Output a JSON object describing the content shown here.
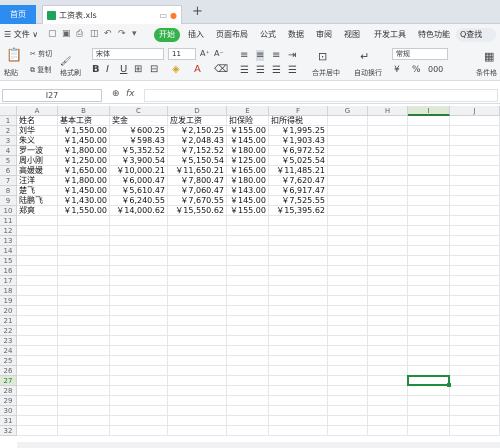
{
  "tabs": {
    "home": "首页",
    "file": "工资表.xls",
    "add": "+"
  },
  "menu": {
    "file": "☰ 文件 ∨",
    "start": "开始",
    "items": [
      "插入",
      "页面布局",
      "公式",
      "数据",
      "审阅",
      "视图",
      "开发工具",
      "特色功能"
    ],
    "search": "Q查找"
  },
  "ribbon": {
    "paste": "粘贴",
    "cut": "剪切",
    "copy": "复制",
    "format_painter": "格式刷",
    "font": "宋体",
    "font_size": "11",
    "merge": "合并居中",
    "wrap": "自动换行",
    "number_format": "常规",
    "currency": "¥",
    "percent": "%",
    "conditional": "条件格"
  },
  "formula_bar": {
    "name_box": "I27",
    "fx": "fx"
  },
  "columns": [
    "A",
    "B",
    "C",
    "D",
    "E",
    "F",
    "G",
    "H",
    "I",
    "J"
  ],
  "rows": [
    "1",
    "2",
    "3",
    "4",
    "5",
    "6",
    "7",
    "8",
    "9",
    "10",
    "11",
    "12",
    "13",
    "14",
    "15",
    "16",
    "17",
    "18",
    "19",
    "20",
    "21",
    "22",
    "23",
    "24",
    "25",
    "26",
    "27",
    "28",
    "29",
    "30",
    "31",
    "32"
  ],
  "table": {
    "headers": [
      "姓名",
      "基本工资",
      "奖金",
      "应发工资",
      "扣保险",
      "扣所得税"
    ],
    "rows": [
      [
        "刘华",
        "￥1,550.00",
        "￥600.25",
        "￥2,150.25",
        "￥155.00",
        "￥1,995.25"
      ],
      [
        "朱义",
        "￥1,450.00",
        "￥598.43",
        "￥2,048.43",
        "￥145.00",
        "￥1,903.43"
      ],
      [
        "罗一波",
        "￥1,800.00",
        "￥5,352.52",
        "￥7,152.52",
        "￥180.00",
        "￥6,972.52"
      ],
      [
        "周小刚",
        "￥1,250.00",
        "￥3,900.54",
        "￥5,150.54",
        "￥125.00",
        "￥5,025.54"
      ],
      [
        "高媛媛",
        "￥1,650.00",
        "￥10,000.21",
        "￥11,650.21",
        "￥165.00",
        "￥11,485.21"
      ],
      [
        "汪洋",
        "￥1,800.00",
        "￥6,000.47",
        "￥7,800.47",
        "￥180.00",
        "￥7,620.47"
      ],
      [
        "楚飞",
        "￥1,450.00",
        "￥5,610.47",
        "￥7,060.47",
        "￥143.00",
        "￥6,917.47"
      ],
      [
        "陆鹏飞",
        "￥1,430.00",
        "￥6,240.55",
        "￥7,670.55",
        "￥145.00",
        "￥7,525.55"
      ],
      [
        "郑爽",
        "￥1,550.00",
        "￥14,000.62",
        "￥15,550.62",
        "￥155.00",
        "￥15,395.62"
      ]
    ]
  },
  "selected_cell": "I27"
}
